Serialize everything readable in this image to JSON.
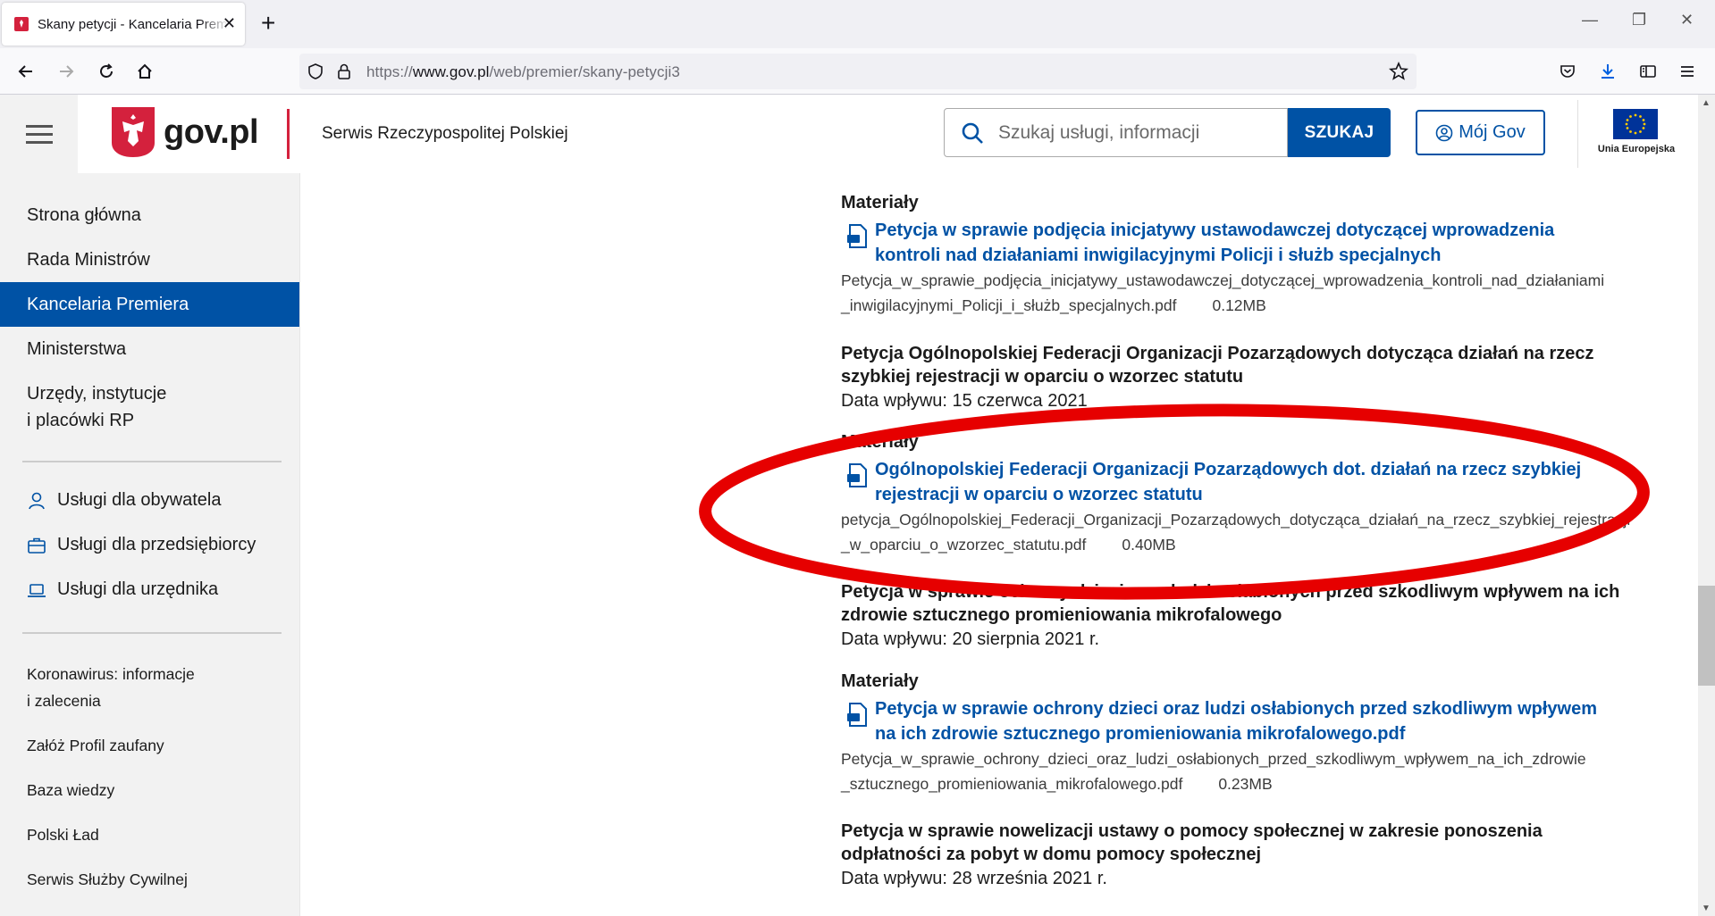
{
  "browser": {
    "tab_title": "Skany petycji - Kancelaria Premiera",
    "url_prefix": "https://",
    "url_domain": "www.gov.pl",
    "url_path": "/web/premier/skany-petycji3"
  },
  "header": {
    "logo_text": "gov.pl",
    "service_name": "Serwis Rzeczypospolitej Polskiej",
    "search_placeholder": "Szukaj usługi, informacji",
    "search_button": "SZUKAJ",
    "mojgov_button": "Mój Gov",
    "eu_label": "Unia Europejska"
  },
  "sidebar": {
    "nav": [
      "Strona główna",
      "Rada Ministrów",
      "Kancelaria Premiera",
      "Ministerstwa",
      "Urzędy, instytucje",
      "i placówki RP"
    ],
    "services": [
      "Usługi dla obywatela",
      "Usługi dla przedsiębiorcy",
      "Usługi dla urzędnika"
    ],
    "links": [
      "Koronawirus: informacje",
      "i zalecenia",
      "Załóż Profil zaufany",
      "Baza wiedzy",
      "Polski Ład",
      "Serwis Służby Cywilnej"
    ]
  },
  "content": {
    "materials_label": "Materiały",
    "items": [
      {
        "link_line1": "Petycja w sprawie podjęcia inicjatywy ustawodawczej dotyczącej wprowadzenia",
        "link_line2": "kontroli nad działaniami inwigilacyjnymi Policji i służb specjalnych",
        "file_line1": "Petycja_w_sprawie_podjęcia_inicjatywy_ustawodawczej_dotyczącej_wprowadzenia_kontroli_nad_działaniami",
        "file_line2": "_inwigilacyjnymi_Policji_i_służb_specjalnych.pdf",
        "size": "0.12MB"
      },
      {
        "title_line1": "Petycja Ogólnopolskiej Federacji Organizacji Pozarządowych dotycząca działań na rzecz",
        "title_line2": "szybkiej rejestracji w oparciu o wzorzec statutu",
        "date": "Data wpływu: 15 czerwca 2021",
        "link_line1": "Ogólnopolskiej Federacji Organizacji Pozarządowych dot. działań na rzecz szybkiej",
        "link_line2": "rejestracji w oparciu o wzorzec statutu",
        "file_line1": "petycja_Ogólnopolskiej_Federacji_Organizacji_Pozarządowych_dotycząca_działań_na_rzecz_szybkiej_rejestracji",
        "file_line2": "_w_oparciu_o_wzorzec_statutu.pdf",
        "size": "0.40MB"
      },
      {
        "title_line1": "Petycja w sprawie ochrony dzieci oraz ludzi osłabionych przed szkodliwym wpływem na ich",
        "title_line2": "zdrowie sztucznego promieniowania mikrofalowego",
        "date": "Data wpływu: 20 sierpnia 2021 r.",
        "link_line1": "Petycja w sprawie ochrony dzieci oraz ludzi osłabionych przed szkodliwym wpływem",
        "link_line2": "na ich zdrowie sztucznego promieniowania mikrofalowego.pdf",
        "file_line1": "Petycja_w_sprawie_ochrony_dzieci_oraz_ludzi_osłabionych_przed_szkodliwym_wpływem_na_ich_zdrowie",
        "file_line2": "_sztucznego_promieniowania_mikrofalowego.pdf",
        "size": "0.23MB"
      },
      {
        "title_line1": "Petycja w sprawie nowelizacji ustawy o pomocy społecznej w zakresie ponoszenia",
        "title_line2": "odpłatności za pobyt w domu pomocy społecznej",
        "date": "Data wpływu: 28 września 2021 r."
      }
    ]
  },
  "colors": {
    "brand_blue": "#0052a5",
    "annotation_red": "#e60000",
    "gov_red": "#d4213d"
  }
}
